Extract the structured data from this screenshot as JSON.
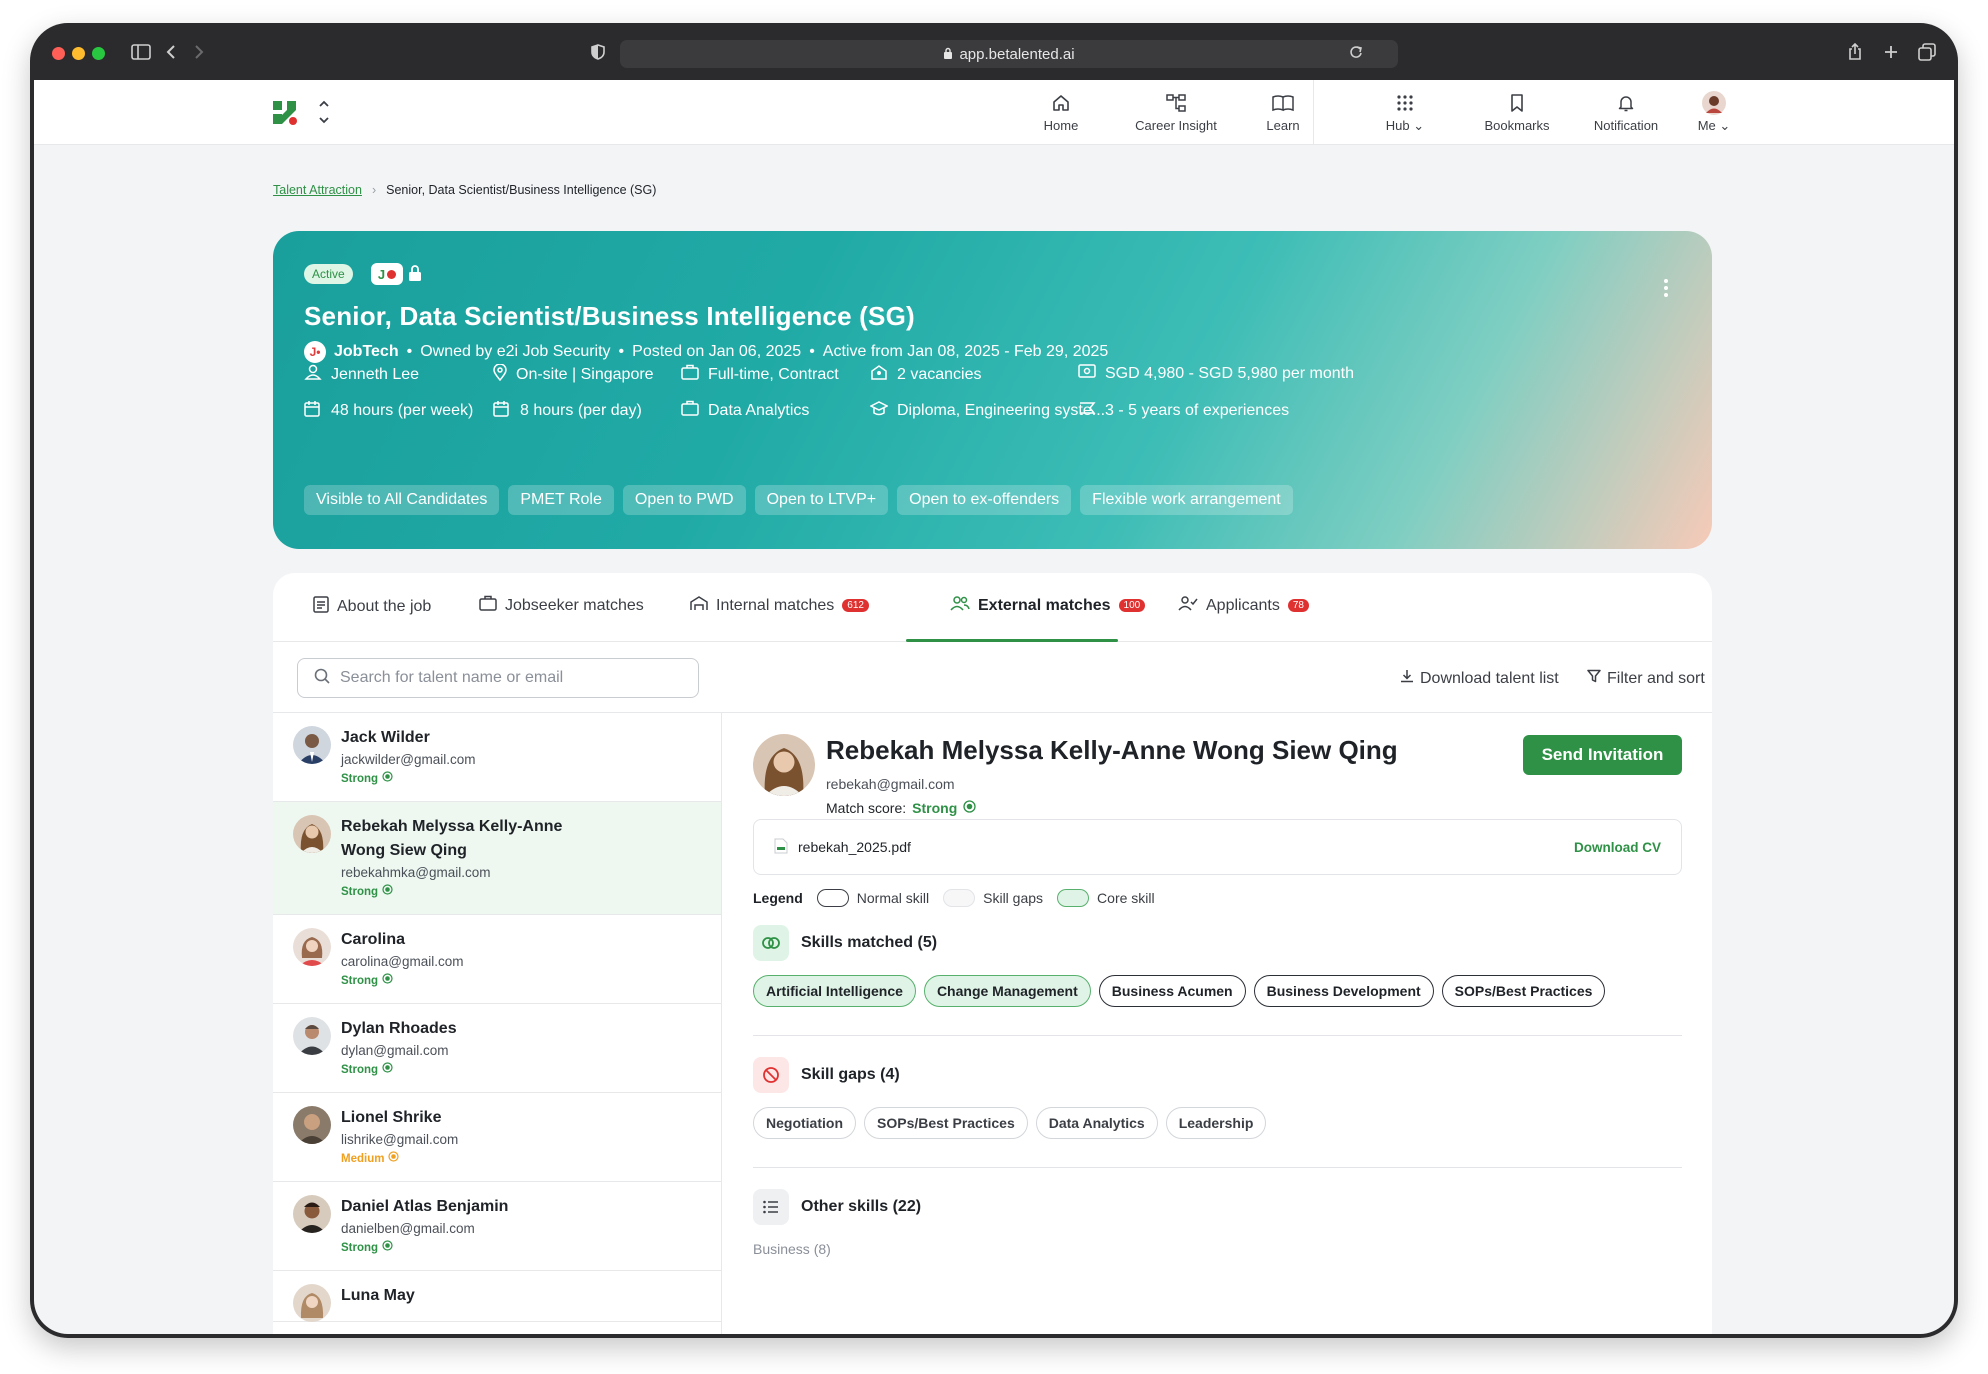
{
  "browser": {
    "url": "app.betalented.ai"
  },
  "nav": {
    "items": [
      {
        "label": "Home",
        "icon": "home-icon"
      },
      {
        "label": "Career Insight",
        "icon": "career-insight-icon"
      },
      {
        "label": "Learn",
        "icon": "book-icon"
      },
      {
        "label": "Hub",
        "icon": "grid-icon"
      },
      {
        "label": "Bookmarks",
        "icon": "bookmark-icon"
      },
      {
        "label": "Notification",
        "icon": "bell-icon"
      },
      {
        "label": "Me",
        "icon": "avatar"
      }
    ]
  },
  "breadcrumb": {
    "parent": "Talent Attraction",
    "current": "Senior, Data Scientist/Business Intelligence (SG)"
  },
  "job": {
    "status": "Active",
    "title": "Senior, Data Scientist/Business Intelligence (SG)",
    "source": "JobTech",
    "owned_by": "Owned by e2i Job Security",
    "posted": "Posted on Jan 06, 2025",
    "active_range": "Active from Jan 08, 2025 - Feb 29, 2025",
    "attributes": {
      "contact": "Jenneth Lee",
      "location": "On-site | Singapore",
      "employment": "Full-time, Contract",
      "vacancies": "2 vacancies",
      "salary": "SGD 4,980 - SGD 5,980 per month",
      "weekly_hours": "48 hours (per week)",
      "daily_hours": "8 hours (per day)",
      "field": "Data Analytics",
      "education": "Diploma, Engineering syste...",
      "experience": "3 - 5 years of experiences"
    },
    "tags": [
      "Visible to All Candidates",
      "PMET Role",
      "Open to PWD",
      "Open to LTVP+",
      "Open to ex-offenders",
      "Flexible work arrangement"
    ]
  },
  "tabs": [
    {
      "label": "About the job",
      "count": ""
    },
    {
      "label": "Jobseeker matches",
      "count": ""
    },
    {
      "label": "Internal matches",
      "count": "612"
    },
    {
      "label": "External matches",
      "count": "100"
    },
    {
      "label": "Applicants",
      "count": "78"
    }
  ],
  "toolbar": {
    "search_placeholder": "Search for talent name or email",
    "download": "Download talent list",
    "filter": "Filter and sort"
  },
  "talents": [
    {
      "name": "Jack Wilder",
      "email": "jackwilder@gmail.com",
      "match": "Strong"
    },
    {
      "name": "Rebekah Melyssa Kelly-Anne Wong Siew Qing",
      "email": "rebekahmka@gmail.com",
      "match": "Strong"
    },
    {
      "name": "Carolina",
      "email": "carolina@gmail.com",
      "match": "Strong"
    },
    {
      "name": "Dylan Rhoades",
      "email": "dylan@gmail.com",
      "match": "Strong"
    },
    {
      "name": "Lionel Shrike",
      "email": "lishrike@gmail.com",
      "match": "Medium"
    },
    {
      "name": "Daniel Atlas Benjamin",
      "email": "danielben@gmail.com",
      "match": "Strong"
    },
    {
      "name": "Luna May",
      "email": "",
      "match": ""
    }
  ],
  "detail": {
    "name": "Rebekah Melyssa Kelly-Anne Wong Siew Qing",
    "email": "rebekah@gmail.com",
    "match_label": "Match score:",
    "match": "Strong",
    "send_label": "Send Invitation",
    "cv_file": "rebekah_2025.pdf",
    "cv_download": "Download CV",
    "legend": {
      "title": "Legend",
      "normal": "Normal skill",
      "gaps": "Skill gaps",
      "core": "Core skill"
    },
    "skills_matched_title": "Skills matched (5)",
    "skills_matched": [
      "Artificial Intelligence",
      "Change Management",
      "Business Acumen",
      "Business Development",
      "SOPs/Best Practices"
    ],
    "skill_gaps_title": "Skill gaps (4)",
    "skill_gaps": [
      "Negotiation",
      "SOPs/Best Practices",
      "Data Analytics",
      "Leadership"
    ],
    "other_skills_title": "Other skills (22)",
    "other_group": "Business (8)"
  },
  "colors": {
    "accent": "#2e9146",
    "medium": "#f0a020",
    "badge": "#e03131",
    "hero_start": "#1a9f9c",
    "hero_end": "#f7cab8"
  }
}
